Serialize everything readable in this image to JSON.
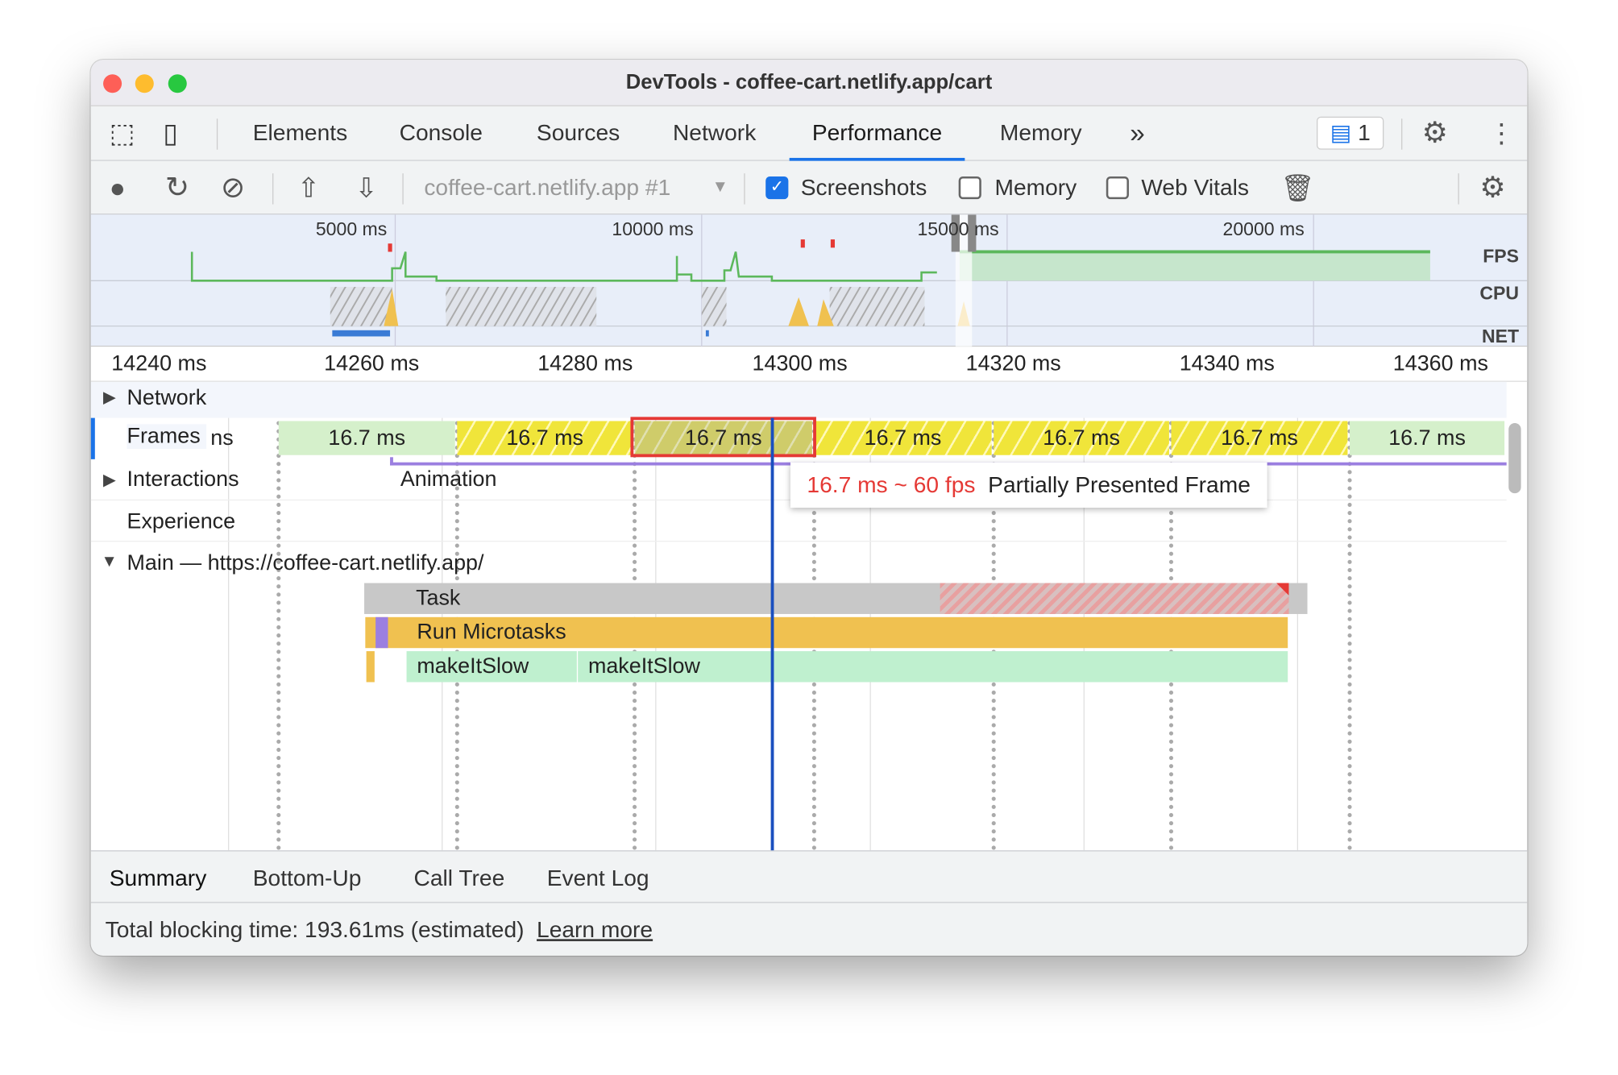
{
  "window": {
    "title": "DevTools - coffee-cart.netlify.app/cart"
  },
  "tabs": [
    {
      "label": "Elements"
    },
    {
      "label": "Console"
    },
    {
      "label": "Sources"
    },
    {
      "label": "Network"
    },
    {
      "label": "Performance",
      "active": true
    },
    {
      "label": "Memory"
    }
  ],
  "tabs_more": "»",
  "issues_badge": "1",
  "toolbar": {
    "profile_select": "coffee-cart.netlify.app #1",
    "screenshots_label": "Screenshots",
    "screenshots_checked": true,
    "memory_label": "Memory",
    "memory_checked": false,
    "webvitals_label": "Web Vitals",
    "webvitals_checked": false
  },
  "overview": {
    "ticks": [
      "5000 ms",
      "10000 ms",
      "15000 ms",
      "20000 ms"
    ],
    "lanes": [
      "FPS",
      "CPU",
      "NET"
    ]
  },
  "ruler": {
    "ticks": [
      "14240 ms",
      "14260 ms",
      "14280 ms",
      "14300 ms",
      "14320 ms",
      "14340 ms",
      "14360 ms"
    ]
  },
  "tracks": {
    "network": "Network",
    "frames": "Frames",
    "interactions": "Interactions",
    "experience": "Experience",
    "main": "Main — https://coffee-cart.netlify.app/"
  },
  "frames": [
    {
      "label": "16.7 ms",
      "state": "presented"
    },
    {
      "label": "16.7 ms",
      "state": "partial"
    },
    {
      "label": "16.7 ms",
      "state": "selected"
    },
    {
      "label": "16.7 ms",
      "state": "partial"
    },
    {
      "label": "16.7 ms",
      "state": "partial"
    },
    {
      "label": "16.7 ms",
      "state": "partial"
    },
    {
      "label": "16.7 ms",
      "state": "presented"
    }
  ],
  "frames_cut_label": "ns",
  "interaction": "Animation",
  "tooltip": {
    "fps": "16.7 ms ~ 60 fps",
    "desc": "Partially Presented Frame"
  },
  "flame": {
    "task": "Task",
    "microtasks": "Run Microtasks",
    "fn1": "makeItSlow",
    "fn2": "makeItSlow"
  },
  "bottom_tabs": [
    "Summary",
    "Bottom-Up",
    "Call Tree",
    "Event Log"
  ],
  "status": {
    "text": "Total blocking time: 193.61ms (estimated)",
    "link": "Learn more"
  },
  "colors": {
    "accent": "#1a73e8",
    "frame_partial": "#f0e53a",
    "frame_presented": "#d5f0cb",
    "task": "#c8c8c8",
    "microtasks": "#f0c150",
    "script": "#bff0cf",
    "selection": "#e53935"
  }
}
